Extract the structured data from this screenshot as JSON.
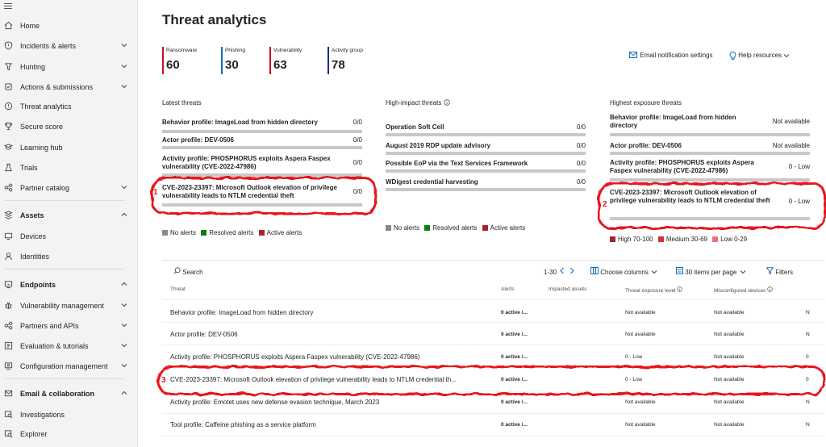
{
  "sidebar": {
    "items": [
      {
        "label": "Home",
        "icon": "home-icon",
        "chevron": false,
        "bold": false
      },
      {
        "label": "Incidents & alerts",
        "icon": "shield-icon",
        "chevron": true,
        "bold": false
      },
      {
        "label": "Hunting",
        "icon": "hunting-icon",
        "chevron": true,
        "bold": false
      },
      {
        "label": "Actions & submissions",
        "icon": "actions-icon",
        "chevron": true,
        "bold": false
      },
      {
        "label": "Threat analytics",
        "icon": "threat-analytics-icon",
        "chevron": false,
        "bold": false
      },
      {
        "label": "Secure score",
        "icon": "trophy-icon",
        "chevron": false,
        "bold": false
      },
      {
        "label": "Learning hub",
        "icon": "learning-icon",
        "chevron": false,
        "bold": false
      },
      {
        "label": "Trials",
        "icon": "trials-icon",
        "chevron": false,
        "bold": false
      },
      {
        "label": "Partner catalog",
        "icon": "partner-icon",
        "chevron": true,
        "bold": false
      },
      {
        "label": "Assets",
        "icon": "assets-icon",
        "chevron": true,
        "bold": true
      },
      {
        "label": "Devices",
        "icon": "devices-icon",
        "chevron": false,
        "bold": false
      },
      {
        "label": "Identities",
        "icon": "person-icon",
        "chevron": false,
        "bold": false
      },
      {
        "label": "Endpoints",
        "icon": "endpoints-icon",
        "chevron": true,
        "bold": true
      },
      {
        "label": "Vulnerability management",
        "icon": "bug-icon",
        "chevron": true,
        "bold": false
      },
      {
        "label": "Partners and APIs",
        "icon": "partner-icon",
        "chevron": true,
        "bold": false
      },
      {
        "label": "Evaluation & tutorials",
        "icon": "evaluation-icon",
        "chevron": true,
        "bold": false
      },
      {
        "label": "Configuration management",
        "icon": "config-icon",
        "chevron": true,
        "bold": false
      },
      {
        "label": "Email & collaboration",
        "icon": "mail-icon",
        "chevron": true,
        "bold": true
      },
      {
        "label": "Investigations",
        "icon": "investigations-icon",
        "chevron": false,
        "bold": false
      },
      {
        "label": "Explorer",
        "icon": "explorer-icon",
        "chevron": false,
        "bold": false
      }
    ]
  },
  "page": {
    "title": "Threat analytics"
  },
  "stats": [
    {
      "label": "Ransomware",
      "value": "60",
      "color": "#c50f1f"
    },
    {
      "label": "Phishing",
      "value": "30",
      "color": "#0f6cbd"
    },
    {
      "label": "Vulnerability",
      "value": "63",
      "color": "#c50f1f"
    },
    {
      "label": "Activity group",
      "value": "78",
      "color": "#1b2a8c"
    }
  ],
  "header_links": {
    "email": "Email notification settings",
    "help": "Help resources"
  },
  "latest": {
    "title": "Latest threats",
    "rows": [
      {
        "name": "Behavior profile: ImageLoad from hidden directory",
        "count": "0/0"
      },
      {
        "name": "Actor profile: DEV-0506",
        "count": "0/0"
      },
      {
        "name": "Activity profile: PHOSPHORUS exploits Aspera Faspex vulnerability (CVE-2022-47986)",
        "count": "0/0"
      },
      {
        "name": "CVE-2023-23397: Microsoft Outlook elevation of privilege vulnerability leads to NTLM credential theft",
        "count": "0/0"
      }
    ],
    "legend": [
      "No alerts",
      "Resolved alerts",
      "Active alerts"
    ]
  },
  "high_impact": {
    "title": "High-impact threats",
    "info_icon": "info-icon",
    "rows": [
      {
        "name": "Operation Soft Cell",
        "count": "0/0"
      },
      {
        "name": "August 2019 RDP update advisory",
        "count": "0/0"
      },
      {
        "name": "Possible EoP via the Text Services Framework",
        "count": "0/0"
      },
      {
        "name": "WDigest credential harvesting",
        "count": "0/0"
      }
    ],
    "legend": [
      "No alerts",
      "Resolved alerts",
      "Active alerts"
    ]
  },
  "exposure": {
    "title": "Highest exposure threats",
    "rows": [
      {
        "name": "Behavior profile: ImageLoad from hidden directory",
        "count": "Not available"
      },
      {
        "name": "Actor profile: DEV-0506",
        "count": "Not available"
      },
      {
        "name": "Activity profile: PHOSPHORUS exploits Aspera Faspex vulnerability (CVE-2022-47986)",
        "count": "0 - Low"
      },
      {
        "name": "CVE-2023-23397: Microsoft Outlook elevation of privilege vulnerability leads to NTLM credential theft",
        "count": "0 - Low"
      }
    ],
    "legend": [
      "High 70-100",
      "Medium 30-69",
      "Low 0-29"
    ]
  },
  "toolbar": {
    "search": "Search",
    "paging": "1-30",
    "choose_columns": "Choose columns",
    "items_per_page": "30 items per page",
    "filters": "Filters"
  },
  "table": {
    "columns": [
      "Threat",
      "Alerts",
      "Impacted assets",
      "Threat exposure level",
      "Misconfigured devices",
      "N"
    ],
    "rows": [
      {
        "threat": "Behavior profile: ImageLoad from hidden directory",
        "alerts": "0 active /...",
        "exposure": "Not available",
        "misconfig": "Not available",
        "n": "N"
      },
      {
        "threat": "Actor profile: DEV-0506",
        "alerts": "0 active /...",
        "exposure": "Not available",
        "misconfig": "Not available",
        "n": "N"
      },
      {
        "threat": "Activity profile: PHOSPHORUS exploits Aspera Faspex vulnerability (CVE-2022-47986)",
        "alerts": "0 active /...",
        "exposure": "0 - Low",
        "misconfig": "Not available",
        "n": "0"
      },
      {
        "threat": "CVE-2023-23397: Microsoft Outlook elevation of privilege vulnerability leads to NTLM credential th...",
        "alerts": "0 active /...",
        "exposure": "0 - Low",
        "misconfig": "Not available",
        "n": "0"
      },
      {
        "threat": "Activity profile: Emotet uses new defense evasion technique, March 2023",
        "alerts": "0 active /...",
        "exposure": "Not available",
        "misconfig": "Not available",
        "n": "N"
      },
      {
        "threat": "Tool profile: Caffeine phishing as a service platform",
        "alerts": "0 active /...",
        "exposure": "Not available",
        "misconfig": "Not available",
        "n": "N"
      }
    ]
  },
  "annotations": [
    "1",
    "2",
    "3"
  ],
  "colors": {
    "accent": "#0f6cbd",
    "markup": "#e8161b",
    "no_alerts": "#8a8a8a",
    "resolved": "#107c10",
    "active": "#a4262c",
    "high": "#a4262c",
    "medium": "#d13438",
    "low": "#f1707b"
  }
}
